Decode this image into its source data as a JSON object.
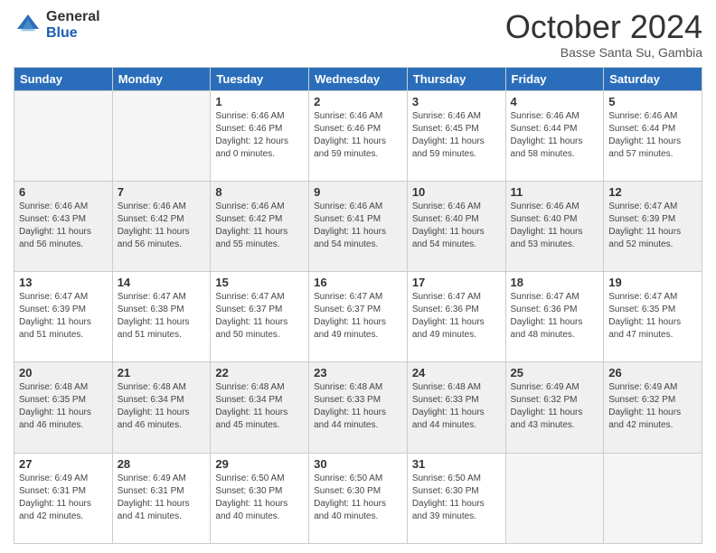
{
  "header": {
    "logo_general": "General",
    "logo_blue": "Blue",
    "month_title": "October 2024",
    "subtitle": "Basse Santa Su, Gambia"
  },
  "weekdays": [
    "Sunday",
    "Monday",
    "Tuesday",
    "Wednesday",
    "Thursday",
    "Friday",
    "Saturday"
  ],
  "weeks": [
    [
      {
        "day": "",
        "info": ""
      },
      {
        "day": "",
        "info": ""
      },
      {
        "day": "1",
        "info": "Sunrise: 6:46 AM\nSunset: 6:46 PM\nDaylight: 12 hours\nand 0 minutes."
      },
      {
        "day": "2",
        "info": "Sunrise: 6:46 AM\nSunset: 6:46 PM\nDaylight: 11 hours\nand 59 minutes."
      },
      {
        "day": "3",
        "info": "Sunrise: 6:46 AM\nSunset: 6:45 PM\nDaylight: 11 hours\nand 59 minutes."
      },
      {
        "day": "4",
        "info": "Sunrise: 6:46 AM\nSunset: 6:44 PM\nDaylight: 11 hours\nand 58 minutes."
      },
      {
        "day": "5",
        "info": "Sunrise: 6:46 AM\nSunset: 6:44 PM\nDaylight: 11 hours\nand 57 minutes."
      }
    ],
    [
      {
        "day": "6",
        "info": "Sunrise: 6:46 AM\nSunset: 6:43 PM\nDaylight: 11 hours\nand 56 minutes."
      },
      {
        "day": "7",
        "info": "Sunrise: 6:46 AM\nSunset: 6:42 PM\nDaylight: 11 hours\nand 56 minutes."
      },
      {
        "day": "8",
        "info": "Sunrise: 6:46 AM\nSunset: 6:42 PM\nDaylight: 11 hours\nand 55 minutes."
      },
      {
        "day": "9",
        "info": "Sunrise: 6:46 AM\nSunset: 6:41 PM\nDaylight: 11 hours\nand 54 minutes."
      },
      {
        "day": "10",
        "info": "Sunrise: 6:46 AM\nSunset: 6:40 PM\nDaylight: 11 hours\nand 54 minutes."
      },
      {
        "day": "11",
        "info": "Sunrise: 6:46 AM\nSunset: 6:40 PM\nDaylight: 11 hours\nand 53 minutes."
      },
      {
        "day": "12",
        "info": "Sunrise: 6:47 AM\nSunset: 6:39 PM\nDaylight: 11 hours\nand 52 minutes."
      }
    ],
    [
      {
        "day": "13",
        "info": "Sunrise: 6:47 AM\nSunset: 6:39 PM\nDaylight: 11 hours\nand 51 minutes."
      },
      {
        "day": "14",
        "info": "Sunrise: 6:47 AM\nSunset: 6:38 PM\nDaylight: 11 hours\nand 51 minutes."
      },
      {
        "day": "15",
        "info": "Sunrise: 6:47 AM\nSunset: 6:37 PM\nDaylight: 11 hours\nand 50 minutes."
      },
      {
        "day": "16",
        "info": "Sunrise: 6:47 AM\nSunset: 6:37 PM\nDaylight: 11 hours\nand 49 minutes."
      },
      {
        "day": "17",
        "info": "Sunrise: 6:47 AM\nSunset: 6:36 PM\nDaylight: 11 hours\nand 49 minutes."
      },
      {
        "day": "18",
        "info": "Sunrise: 6:47 AM\nSunset: 6:36 PM\nDaylight: 11 hours\nand 48 minutes."
      },
      {
        "day": "19",
        "info": "Sunrise: 6:47 AM\nSunset: 6:35 PM\nDaylight: 11 hours\nand 47 minutes."
      }
    ],
    [
      {
        "day": "20",
        "info": "Sunrise: 6:48 AM\nSunset: 6:35 PM\nDaylight: 11 hours\nand 46 minutes."
      },
      {
        "day": "21",
        "info": "Sunrise: 6:48 AM\nSunset: 6:34 PM\nDaylight: 11 hours\nand 46 minutes."
      },
      {
        "day": "22",
        "info": "Sunrise: 6:48 AM\nSunset: 6:34 PM\nDaylight: 11 hours\nand 45 minutes."
      },
      {
        "day": "23",
        "info": "Sunrise: 6:48 AM\nSunset: 6:33 PM\nDaylight: 11 hours\nand 44 minutes."
      },
      {
        "day": "24",
        "info": "Sunrise: 6:48 AM\nSunset: 6:33 PM\nDaylight: 11 hours\nand 44 minutes."
      },
      {
        "day": "25",
        "info": "Sunrise: 6:49 AM\nSunset: 6:32 PM\nDaylight: 11 hours\nand 43 minutes."
      },
      {
        "day": "26",
        "info": "Sunrise: 6:49 AM\nSunset: 6:32 PM\nDaylight: 11 hours\nand 42 minutes."
      }
    ],
    [
      {
        "day": "27",
        "info": "Sunrise: 6:49 AM\nSunset: 6:31 PM\nDaylight: 11 hours\nand 42 minutes."
      },
      {
        "day": "28",
        "info": "Sunrise: 6:49 AM\nSunset: 6:31 PM\nDaylight: 11 hours\nand 41 minutes."
      },
      {
        "day": "29",
        "info": "Sunrise: 6:50 AM\nSunset: 6:30 PM\nDaylight: 11 hours\nand 40 minutes."
      },
      {
        "day": "30",
        "info": "Sunrise: 6:50 AM\nSunset: 6:30 PM\nDaylight: 11 hours\nand 40 minutes."
      },
      {
        "day": "31",
        "info": "Sunrise: 6:50 AM\nSunset: 6:30 PM\nDaylight: 11 hours\nand 39 minutes."
      },
      {
        "day": "",
        "info": ""
      },
      {
        "day": "",
        "info": ""
      }
    ]
  ]
}
